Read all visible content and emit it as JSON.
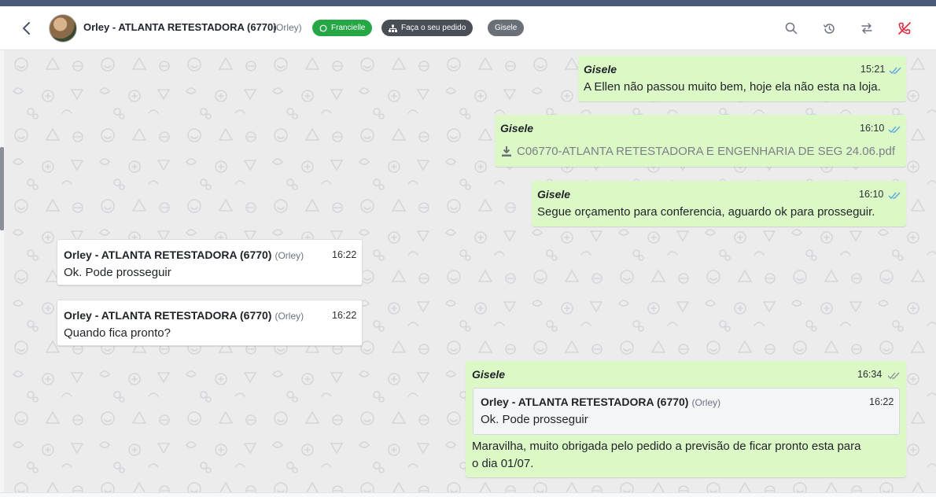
{
  "header": {
    "back_icon": "chevron-left-icon",
    "contact_name": "Orley - ATLANTA RETESTADORA (6770)",
    "contact_alias": "(Orley)",
    "tags": [
      {
        "label": "Francielle",
        "icon": "whatsapp-icon",
        "color": "#25a745"
      },
      {
        "label": "Faça o seu pedido",
        "icon": "sitemap-icon",
        "color": "#4a4f57"
      },
      {
        "label": "Gisele",
        "color": "#6b7078"
      }
    ],
    "actions": [
      "search-icon",
      "history-icon",
      "transfer-icon",
      "phone-off-icon"
    ],
    "end_icon_color": "#e0283c"
  },
  "messages": [
    {
      "direction": "out",
      "sender": "Gisele",
      "time": "15:21",
      "status": "read",
      "text": "A Ellen não passou muito bem, hoje ela não esta na loja."
    },
    {
      "direction": "out",
      "sender": "Gisele",
      "time": "16:10",
      "status": "read",
      "file": "C06770-ATLANTA RETESTADORA E ENGENHARIA DE SEG 24.06.pdf"
    },
    {
      "direction": "out",
      "sender": "Gisele",
      "time": "16:10",
      "status": "read",
      "text": "Segue orçamento para conferencia, aguardo ok para prosseguir."
    },
    {
      "direction": "in",
      "sender": "Orley - ATLANTA RETESTADORA (6770)",
      "alias": "(Orley)",
      "time": "16:22",
      "text": "Ok. Pode prosseguir"
    },
    {
      "direction": "in",
      "sender": "Orley - ATLANTA RETESTADORA (6770)",
      "alias": "(Orley)",
      "time": "16:22",
      "text": "Quando fica pronto?"
    },
    {
      "direction": "out",
      "sender": "Gisele",
      "time": "16:34",
      "status": "delivered",
      "quote": {
        "sender": "Orley - ATLANTA RETESTADORA (6770)",
        "alias": "(Orley)",
        "time": "16:22",
        "text": "Ok. Pode prosseguir"
      },
      "text_line1": "Maravilha, muito obrigada pelo pedido a previsão de ficar pronto esta para",
      "text_line2": "o dia 01/07."
    }
  ],
  "colors": {
    "outgoing_bubble": "#dcf8c6",
    "incoming_bubble": "#ffffff",
    "read_tick": "#4fa3e0",
    "delivered_tick": "#8a8f98"
  }
}
